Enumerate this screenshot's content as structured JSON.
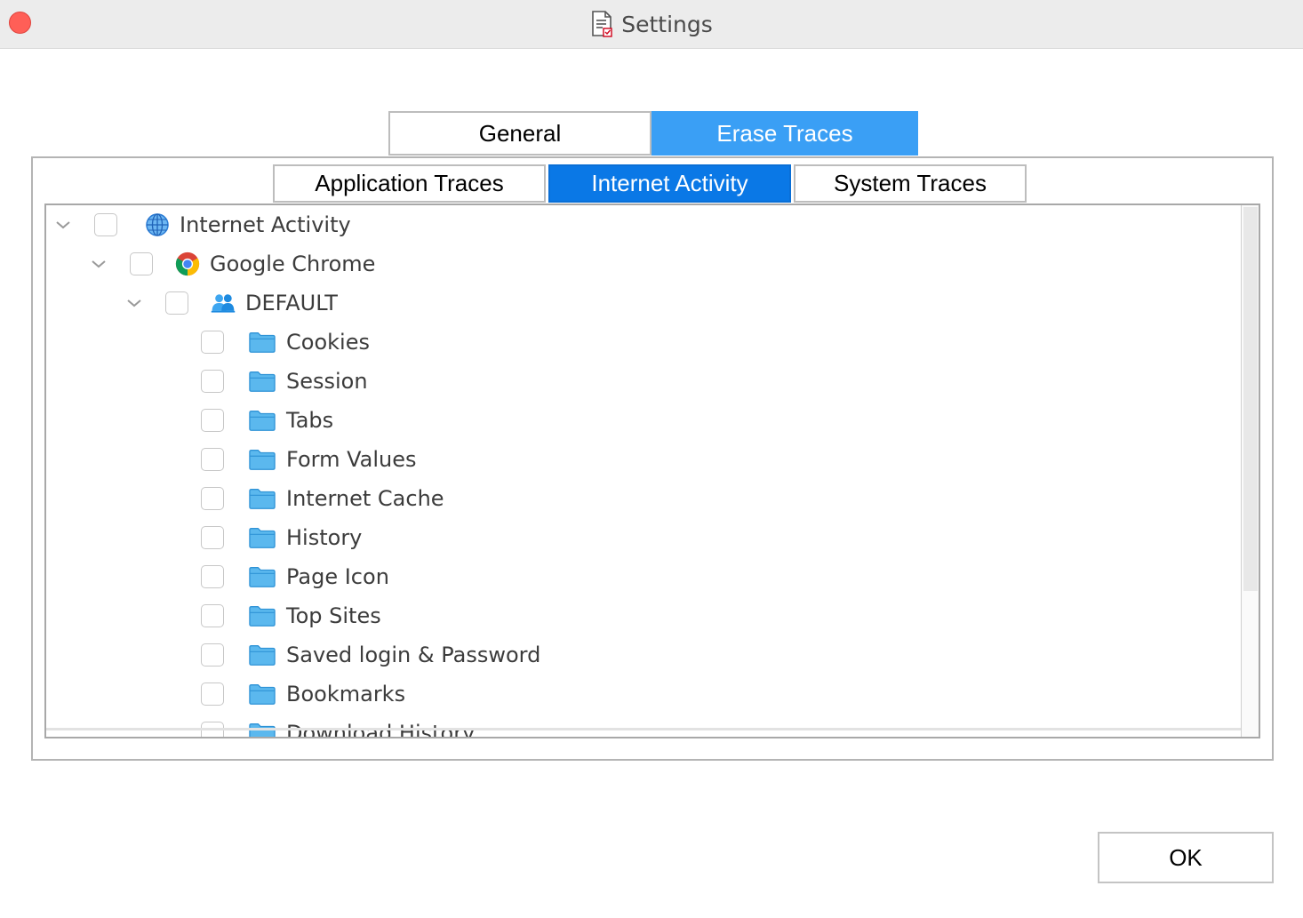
{
  "window": {
    "title": "Settings"
  },
  "tabs": {
    "general": "General",
    "erase_traces": "Erase Traces"
  },
  "subtabs": {
    "application_traces": "Application Traces",
    "internet_activity": "Internet Activity",
    "system_traces": "System Traces"
  },
  "tree": {
    "root": {
      "label": "Internet Activity",
      "icon": "globe-icon"
    },
    "browser": {
      "label": "Google Chrome",
      "icon": "chrome-icon"
    },
    "profile": {
      "label": "DEFAULT",
      "icon": "users-icon"
    },
    "items": [
      {
        "label": "Cookies",
        "icon": "folder-icon"
      },
      {
        "label": "Session",
        "icon": "folder-icon"
      },
      {
        "label": "Tabs",
        "icon": "folder-icon"
      },
      {
        "label": "Form Values",
        "icon": "folder-icon"
      },
      {
        "label": "Internet Cache",
        "icon": "folder-icon"
      },
      {
        "label": "History",
        "icon": "folder-icon"
      },
      {
        "label": "Page Icon",
        "icon": "folder-icon"
      },
      {
        "label": "Top Sites",
        "icon": "folder-icon"
      },
      {
        "label": "Saved login & Password",
        "icon": "folder-icon"
      },
      {
        "label": "Bookmarks",
        "icon": "folder-icon"
      },
      {
        "label": "Download History",
        "icon": "folder-icon"
      }
    ]
  },
  "buttons": {
    "ok": "OK"
  },
  "colors": {
    "accent_tab": "#3a9ff5",
    "selected_subtab": "#0a78e6",
    "folder": "#5bb8ee",
    "close_button": "#ff5f57"
  }
}
